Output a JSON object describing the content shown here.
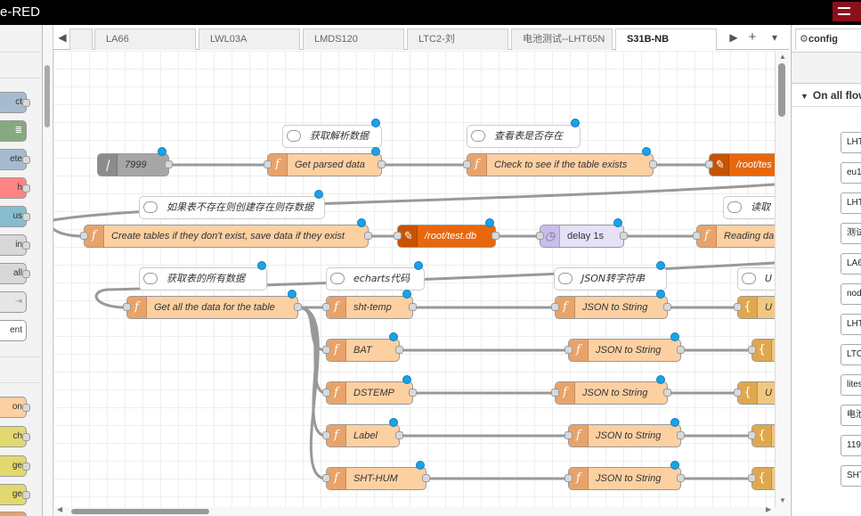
{
  "app": {
    "title": "e-RED"
  },
  "palette": {
    "items": [
      {
        "label": "ct",
        "color": "#a6bbcf"
      },
      {
        "label": "",
        "color": "#87a980"
      },
      {
        "label": "ete",
        "color": "#a6bbcf"
      },
      {
        "label": "h",
        "color": "#ff8585"
      },
      {
        "label": "us",
        "color": "#a6bbcf"
      },
      {
        "label": "in",
        "color": "#a6bbcf"
      },
      {
        "label": "all",
        "color": "#a6bbcf"
      },
      {
        "label": "",
        "color": "#e6e6e6"
      },
      {
        "label": "ent",
        "color": "#ffffff"
      },
      {
        "label": "on",
        "color": "#fdd0a2"
      },
      {
        "label": "ch",
        "color": "#e2d96e"
      },
      {
        "label": "ge",
        "color": "#e2d96e"
      },
      {
        "label": "ge",
        "color": "#e2d96e"
      }
    ]
  },
  "tabs": [
    {
      "label": ""
    },
    {
      "label": "LA66"
    },
    {
      "label": "LWL03A"
    },
    {
      "label": "LMDS120"
    },
    {
      "label": "LTC2-刘"
    },
    {
      "label": "电池测试--LHT65N"
    },
    {
      "label": "S31B-NB",
      "active": true
    }
  ],
  "tab_controls": {
    "scroll_left": "◀",
    "scroll_right": "▶",
    "add": "+",
    "menu": "▾"
  },
  "flow": {
    "comments": [
      {
        "id": "c1",
        "label": "获取解析数据"
      },
      {
        "id": "c2",
        "label": "查看表是否存在"
      },
      {
        "id": "c3",
        "label": "如果表不存在则创建存在则存数据"
      },
      {
        "id": "c4",
        "label": "读取"
      },
      {
        "id": "c5",
        "label": "获取表的所有数据"
      },
      {
        "id": "c6",
        "label": "echarts代码"
      },
      {
        "id": "c7",
        "label": "JSON转字符串"
      },
      {
        "id": "c8",
        "label": "U"
      }
    ],
    "nodes": [
      {
        "id": "n_inject",
        "label": "7999",
        "type": "inject"
      },
      {
        "id": "n_parsed",
        "label": "Get parsed data",
        "type": "function"
      },
      {
        "id": "n_check",
        "label": "Check to see if the table exists",
        "type": "function"
      },
      {
        "id": "n_db1",
        "label": "/root/tes",
        "type": "sqlite"
      },
      {
        "id": "n_create",
        "label": "Create tables if they don't exist, save data if they exist",
        "type": "function"
      },
      {
        "id": "n_db2",
        "label": "/root/test.db",
        "type": "sqlite"
      },
      {
        "id": "n_delay",
        "label": "delay 1s",
        "type": "delay"
      },
      {
        "id": "n_reading",
        "label": "Reading da",
        "type": "function"
      },
      {
        "id": "n_getall",
        "label": "Get all the data for the table",
        "type": "function"
      },
      {
        "id": "n_shttemp",
        "label": "sht-temp",
        "type": "function"
      },
      {
        "id": "n_json1",
        "label": "JSON to String",
        "type": "function"
      },
      {
        "id": "n_u1",
        "label": "U",
        "type": "template"
      },
      {
        "id": "n_bat",
        "label": "BAT",
        "type": "function"
      },
      {
        "id": "n_json2",
        "label": "JSON to String",
        "type": "function"
      },
      {
        "id": "n_u2",
        "label": "",
        "type": "template"
      },
      {
        "id": "n_dstemp",
        "label": "DSTEMP",
        "type": "function"
      },
      {
        "id": "n_json3",
        "label": "JSON to String",
        "type": "function"
      },
      {
        "id": "n_u3",
        "label": "U",
        "type": "template"
      },
      {
        "id": "n_label",
        "label": "Label",
        "type": "function"
      },
      {
        "id": "n_json4",
        "label": "JSON to String",
        "type": "function"
      },
      {
        "id": "n_u4",
        "label": "",
        "type": "template"
      },
      {
        "id": "n_shthum",
        "label": "SHT-HUM",
        "type": "function"
      },
      {
        "id": "n_json5",
        "label": "JSON to String",
        "type": "function"
      },
      {
        "id": "n_u5",
        "label": "",
        "type": "template"
      }
    ]
  },
  "sidebar": {
    "tab_label": "config",
    "section_label": "On all flow",
    "items": [
      "LHT",
      "eu1",
      "LHT",
      "测试",
      "LA6",
      "nod",
      "LHT",
      "LTC",
      "lites",
      "电池",
      "119",
      "SHT"
    ]
  },
  "colors": {
    "function": "#fdd0a2",
    "template": "#f0c87f",
    "sqlite": "#e8670c",
    "delay": "#e6e0f8",
    "inject": "#a6a6a6",
    "changed_dot": "#1da1e6",
    "deploy": "#8c101c"
  }
}
